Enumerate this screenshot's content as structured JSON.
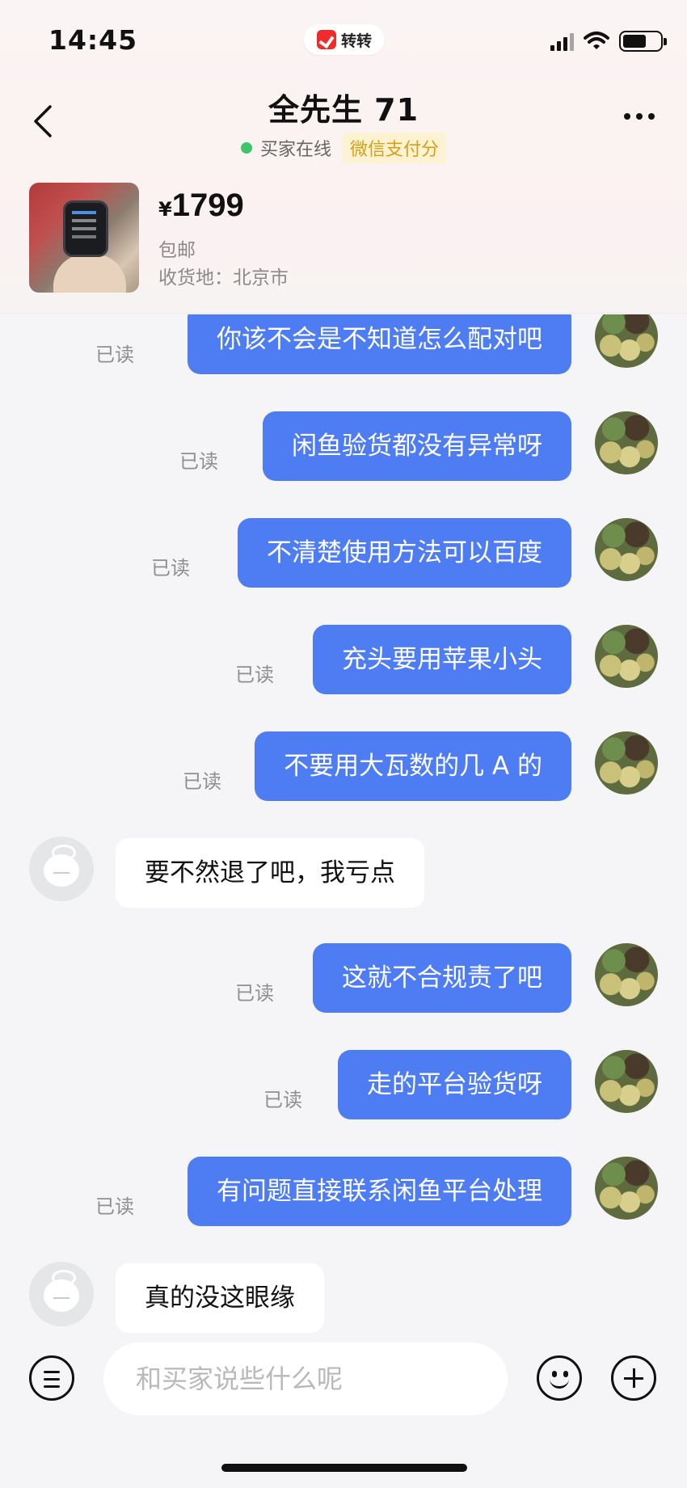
{
  "status_bar": {
    "time": "14:45",
    "app_badge": "转转"
  },
  "header": {
    "title": "全先生 71",
    "online_status": "买家在线",
    "pay_badge": "微信支付分"
  },
  "product": {
    "currency": "¥",
    "price": "1799",
    "shipping": "包邮",
    "address": "收货地：北京市"
  },
  "messages": [
    {
      "from": "me",
      "text": "你该不会是不知道怎么配对吧",
      "status": "已读"
    },
    {
      "from": "me",
      "text": "闲鱼验货都没有异常呀",
      "status": "已读"
    },
    {
      "from": "me",
      "text": "不清楚使用方法可以百度",
      "status": "已读"
    },
    {
      "from": "me",
      "text": "充头要用苹果小头",
      "status": "已读"
    },
    {
      "from": "me",
      "text": "不要用大瓦数的几 A 的",
      "status": "已读"
    },
    {
      "from": "them",
      "text": "要不然退了吧，我亏点"
    },
    {
      "from": "me",
      "text": "这就不合规责了吧",
      "status": "已读"
    },
    {
      "from": "me",
      "text": "走的平台验货呀",
      "status": "已读"
    },
    {
      "from": "me",
      "text": "有问题直接联系闲鱼平台处理",
      "status": "已读"
    },
    {
      "from": "them",
      "text": "真的没这眼缘"
    }
  ],
  "input": {
    "placeholder": "和买家说些什么呢"
  },
  "colors": {
    "my_bubble": "#4e7cf3",
    "their_bubble": "#ffffff",
    "online": "#3ec66a",
    "pay_badge_text": "#d4a017"
  }
}
